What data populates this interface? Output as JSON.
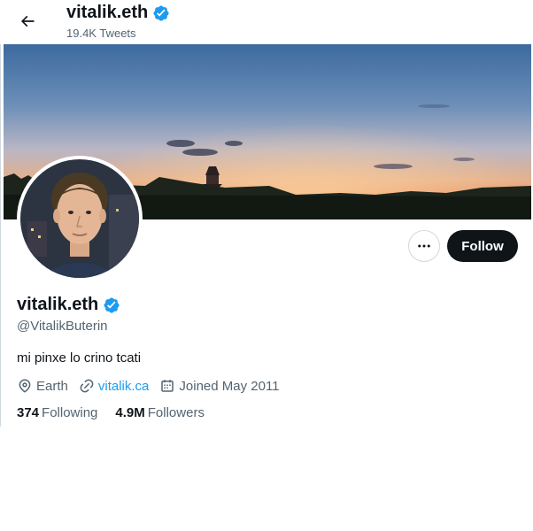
{
  "header": {
    "title": "vitalik.eth",
    "tweets_count": "19.4K Tweets"
  },
  "profile": {
    "name": "vitalik.eth",
    "handle": "@VitalikButerin",
    "bio": "mi pinxe lo crino tcati",
    "location": "Earth",
    "website": "vitalik.ca",
    "joined": "Joined May 2011",
    "following_count": "374",
    "following_label": "Following",
    "followers_count": "4.9M",
    "followers_label": "Followers",
    "verified": true
  },
  "actions": {
    "follow_label": "Follow"
  },
  "icons": {
    "back": "arrow-left-icon",
    "verified": "verified-badge-icon",
    "more": "more-horizontal-icon",
    "location": "location-pin-icon",
    "link": "link-icon",
    "calendar": "calendar-icon"
  },
  "colors": {
    "accent": "#1d9bf0",
    "text_primary": "#0f1419",
    "text_secondary": "#536471",
    "follow_bg": "#0f1419"
  }
}
